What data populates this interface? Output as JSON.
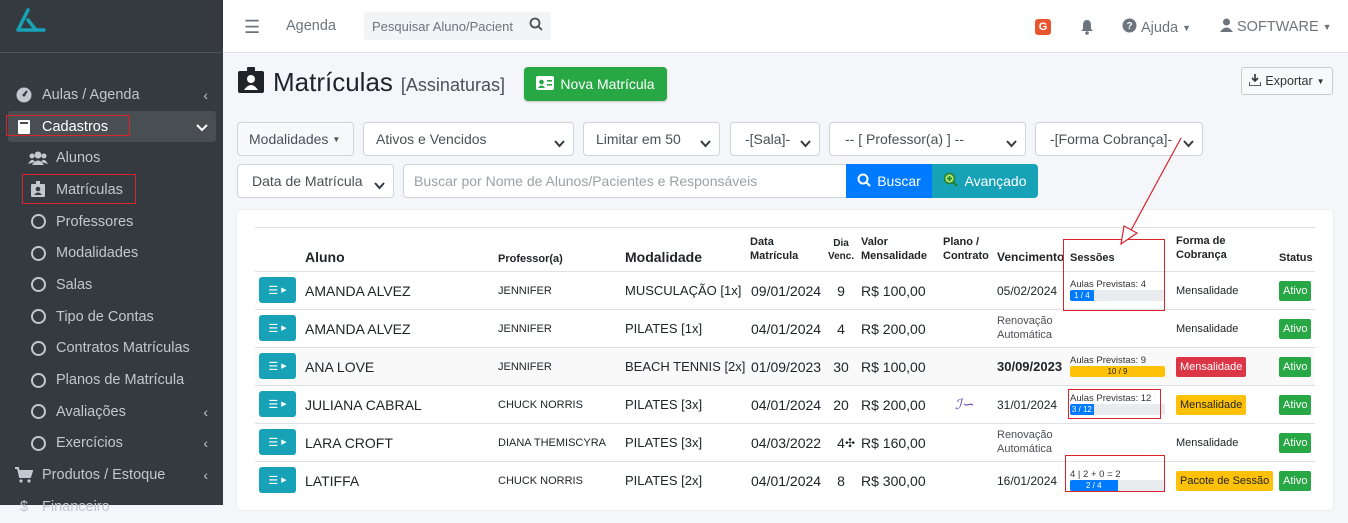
{
  "sidebar": {
    "items": [
      {
        "label": "Aulas / Agenda",
        "icon": "tachometer-icon"
      },
      {
        "label": "Cadastros",
        "icon": "book-icon"
      },
      {
        "label": "Alunos",
        "icon": "users-icon"
      },
      {
        "label": "Matrículas",
        "icon": "id-badge-icon"
      },
      {
        "label": "Professores"
      },
      {
        "label": "Modalidades"
      },
      {
        "label": "Salas"
      },
      {
        "label": "Tipo de Contas"
      },
      {
        "label": "Contratos Matrículas"
      },
      {
        "label": "Planos de Matrícula"
      },
      {
        "label": "Avaliações"
      },
      {
        "label": "Exercícios"
      },
      {
        "label": "Produtos / Estoque",
        "icon": "cart-icon"
      },
      {
        "label": "Financeiro",
        "icon": "dollar-icon"
      }
    ]
  },
  "topbar": {
    "agenda": "Agenda",
    "search_placeholder": "Pesquisar Aluno/Pacient",
    "g_badge": "G",
    "ajuda": "Ajuda",
    "user": "SOFTWARE"
  },
  "page": {
    "title": "Matrículas",
    "subtitle": "[Assinaturas]",
    "nova_btn": "Nova Matrícula",
    "exportar_btn": "Exportar"
  },
  "filters": {
    "modalidades": "Modalidades",
    "status": "Ativos e Vencidos",
    "limit": "Limitar em 50",
    "sala": "-[Sala]-",
    "professor": "-- [ Professor(a) ] --",
    "cobranca": "-[Forma Cobrança]-",
    "date_field": "Data de Matrícula",
    "search_placeholder": "Buscar por Nome de Alunos/Pacientes e Responsáveis",
    "buscar_btn": "Buscar",
    "avancado_btn": "Avançado"
  },
  "table": {
    "headers": {
      "aluno": "Aluno",
      "professor": "Professor(a)",
      "modalidade": "Modalidade",
      "data1": "Data",
      "data2": "Matrícula",
      "dia1": "Dia",
      "dia2": "Venc.",
      "valor1": "Valor",
      "valor2": "Mensalidade",
      "plano1": "Plano /",
      "plano2": "Contrato",
      "vencimento": "Vencimento",
      "sessoes": "Sessões",
      "forma1": "Forma de",
      "forma2": "Cobrança",
      "status": "Status"
    },
    "rows": [
      {
        "aluno": "AMANDA ALVEZ",
        "professor": "JENNIFER",
        "modalidade": "MUSCULAÇÃO [1x]",
        "data": "09/01/2024",
        "dia": "9",
        "valor": "R$ 100,00",
        "venc1": "05/02/2024",
        "venc2": "",
        "sess_label": "Aulas Previstas: 4",
        "sess_bar": "1 / 4",
        "sess_pct": 25,
        "sess_color": "#007bff",
        "forma": "Mensalidade",
        "forma_style": "plain",
        "status": "Ativo"
      },
      {
        "aluno": "AMANDA ALVEZ",
        "professor": "JENNIFER",
        "modalidade": "PILATES [1x]",
        "data": "04/01/2024",
        "dia": "4",
        "valor": "R$ 200,00",
        "venc1": "Renovação",
        "venc2": "Automática",
        "sess_label": "",
        "sess_bar": "",
        "sess_pct": 0,
        "forma": "Mensalidade",
        "forma_style": "plain",
        "status": "Ativo"
      },
      {
        "aluno": "ANA LOVE",
        "professor": "JENNIFER",
        "modalidade": "BEACH TENNIS [2x]",
        "data": "01/09/2023",
        "dia": "30",
        "valor": "R$ 100,00",
        "venc1": "30/09/2023",
        "venc2": "",
        "sess_label": "Aulas Previstas: 9",
        "sess_bar": "10 / 9",
        "sess_pct": 100,
        "sess_color": "#ffc107",
        "forma": "Mensalidade",
        "forma_style": "red",
        "status": "Ativo"
      },
      {
        "aluno": "JULIANA CABRAL",
        "professor": "CHUCK NORRIS",
        "modalidade": "PILATES [3x]",
        "data": "04/01/2024",
        "dia": "20",
        "valor": "R$ 200,00",
        "venc1": "31/01/2024",
        "venc2": "",
        "sess_label": "Aulas Previstas: 12",
        "sess_bar": "3 / 12",
        "sess_pct": 25,
        "sess_color": "#007bff",
        "forma": "Mensalidade",
        "forma_style": "yellow",
        "status": "Ativo"
      },
      {
        "aluno": "LARA CROFT",
        "professor": "DIANA THEMISCYRA",
        "modalidade": "PILATES [3x]",
        "data": "04/03/2022",
        "dia": "4",
        "valor": "R$ 160,00",
        "venc1": "Renovação",
        "venc2": "Automática",
        "sess_label": "",
        "sess_bar": "",
        "sess_pct": 0,
        "forma": "Mensalidade",
        "forma_style": "plain",
        "status": "Ativo"
      },
      {
        "aluno": "LATIFFA",
        "professor": "CHUCK NORRIS",
        "modalidade": "PILATES [2x]",
        "data": "04/01/2024",
        "dia": "8",
        "valor": "R$ 300,00",
        "venc1": "16/01/2024",
        "venc2": "",
        "sess_label": "4 | 2 + 0 = 2",
        "sess_bar": "2 / 4",
        "sess_pct": 50,
        "sess_color": "#007bff",
        "forma": "Pacote de Sessão",
        "forma_style": "yellow",
        "status": "Ativo"
      }
    ]
  },
  "colors": {
    "sidebar": "#343a40",
    "primary": "#007bff",
    "success": "#28a745",
    "info": "#17a2b8",
    "danger": "#dc3545",
    "warning": "#ffc107",
    "annotation": "#d9232d"
  }
}
